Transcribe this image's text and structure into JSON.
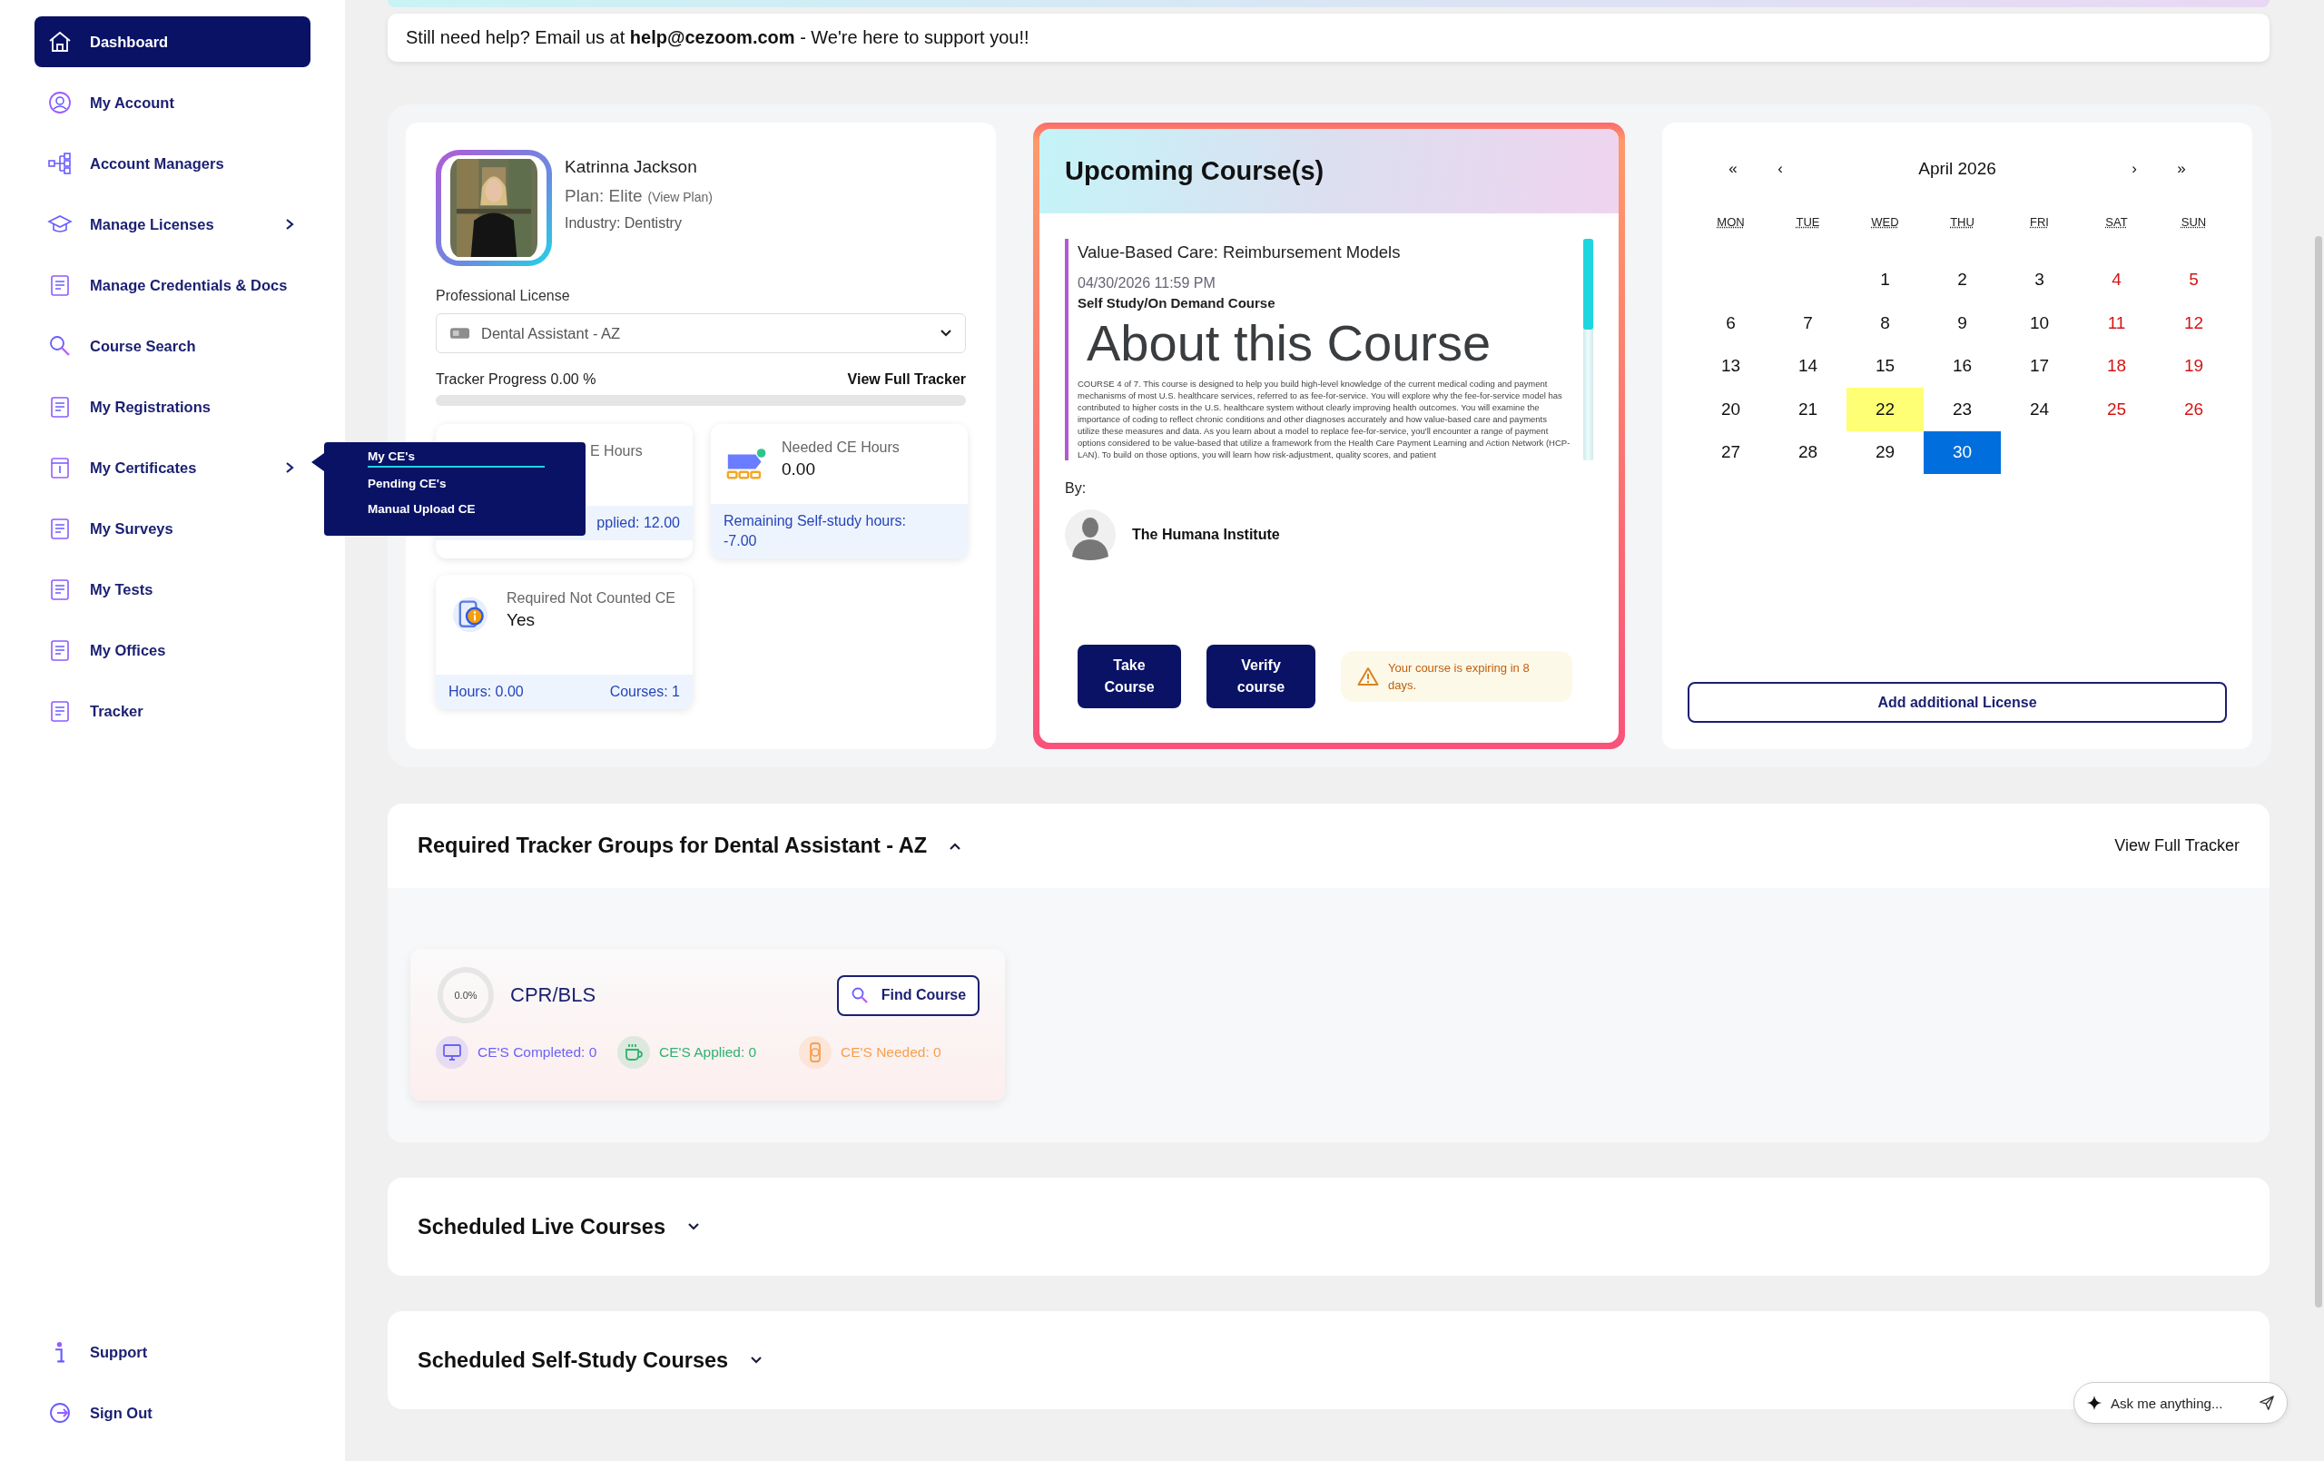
{
  "sidebar": {
    "items": [
      {
        "label": "Dashboard",
        "selected": true,
        "submenu": false
      },
      {
        "label": "My Account",
        "selected": false,
        "submenu": false
      },
      {
        "label": "Account Managers",
        "selected": false,
        "submenu": false
      },
      {
        "label": "Manage Licenses",
        "selected": false,
        "submenu": true
      },
      {
        "label": "Manage Credentials & Docs",
        "selected": false,
        "submenu": false
      },
      {
        "label": "Course Search",
        "selected": false,
        "submenu": false
      },
      {
        "label": "My Registrations",
        "selected": false,
        "submenu": false
      },
      {
        "label": "My Certificates",
        "selected": false,
        "submenu": true
      },
      {
        "label": "My Surveys",
        "selected": false,
        "submenu": false
      },
      {
        "label": "My Tests",
        "selected": false,
        "submenu": false
      },
      {
        "label": "My Offices",
        "selected": false,
        "submenu": false
      },
      {
        "label": "Tracker",
        "selected": false,
        "submenu": false
      }
    ],
    "bottom_items": [
      {
        "label": "Support"
      },
      {
        "label": "Sign Out"
      }
    ]
  },
  "submenu": {
    "items": [
      {
        "label": "My CE's",
        "selected": true
      },
      {
        "label": "Pending CE's",
        "selected": false
      },
      {
        "label": "Manual Upload CE",
        "selected": false
      }
    ]
  },
  "help_banner": "Still need help? Email us at **help@cezoom.com** - We're here to support you!!",
  "profile": {
    "name": "Katrinna Jackson",
    "plan": "Plan: Elite",
    "plan_link": "(View Plan)",
    "industry": "Industry: Dentistry",
    "license_label": "Professional License",
    "license_value": "Dental Assistant - AZ",
    "progress_label": "Tracker Progress 0.00 %",
    "progress_link": "View Full Tracker",
    "level": 0,
    "stats": [
      {
        "label": "E Hours",
        "footer": "pplied: 12.00"
      },
      {
        "label": "Needed CE Hours",
        "value": "0.00",
        "footer": "Remaining Self-study hours: -7.00"
      },
      {
        "label": "Required Not Counted CE",
        "value": "Yes",
        "footer": "Hours: 0.00",
        "footer_2": "Courses: 1"
      }
    ]
  },
  "upcoming": {
    "title": "Upcoming Course(s)",
    "course": {
      "name": "Value-Based Care: Reimbursement Models",
      "date": "04/30/2026 11:59 PM",
      "type": "Self Study/On Demand Course",
      "heading": "About this Course",
      "description": "COURSE 4 of 7. This course is designed to help you build high-level knowledge of the current medical coding and payment mechanisms of most U.S. healthcare services, referred to as fee-for-service. You will explore why the fee-for-service model has contributed to higher costs in the U.S. healthcare system without clearly improving health outcomes. You will examine the importance of coding to reflect chronic conditions and other diagnoses accurately and how value-based care and payments utilize these measures and data. As you learn about a model to replace fee-for-service, you'll encounter a range of payment options considered to be value-based that utilize a framework from the Health Care Payment Learning and Action Network (HCP-LAN). To build on those options, you will learn how risk-adjustment, quality scores, and patient"
    },
    "by_label": "By:",
    "instructor": "The Humana Institute",
    "buttons": [
      "Take Course",
      "Verify course"
    ],
    "warning": "Your course is expiring in 8 days."
  },
  "calendar": {
    "nav_left": [
      "«",
      "‹"
    ],
    "month": "April 2026",
    "nav_right": [
      "›",
      "»"
    ],
    "weekdays": [
      "MON",
      "TUE",
      "WED",
      "THU",
      "FRI",
      "SAT",
      "SUN"
    ],
    "weeks": [
      [
        {
          "day": "1",
          "weekend": false,
          "today": false,
          "selected": false
        },
        {
          "day": "2",
          "weekend": false,
          "today": false,
          "selected": false
        },
        {
          "day": "3",
          "weekend": false,
          "today": false,
          "selected": false
        },
        {
          "day": "4",
          "weekend": true,
          "today": false,
          "selected": false
        },
        {
          "day": "5",
          "weekend": true,
          "today": false,
          "selected": false
        }
      ],
      [
        {
          "day": "6",
          "weekend": false,
          "today": false,
          "selected": false
        },
        {
          "day": "7",
          "weekend": false,
          "today": false,
          "selected": false
        },
        {
          "day": "8",
          "weekend": false,
          "today": false,
          "selected": false
        },
        {
          "day": "9",
          "weekend": false,
          "today": false,
          "selected": false
        },
        {
          "day": "10",
          "weekend": false,
          "today": false,
          "selected": false
        },
        {
          "day": "11",
          "weekend": true,
          "today": false,
          "selected": false
        },
        {
          "day": "12",
          "weekend": true,
          "today": false,
          "selected": false
        }
      ],
      [
        {
          "day": "13",
          "weekend": false,
          "today": false,
          "selected": false
        },
        {
          "day": "14",
          "weekend": false,
          "today": false,
          "selected": false
        },
        {
          "day": "15",
          "weekend": false,
          "today": false,
          "selected": false
        },
        {
          "day": "16",
          "weekend": false,
          "today": false,
          "selected": false
        },
        {
          "day": "17",
          "weekend": false,
          "today": false,
          "selected": false
        },
        {
          "day": "18",
          "weekend": true,
          "today": false,
          "selected": false
        },
        {
          "day": "19",
          "weekend": true,
          "today": false,
          "selected": false
        }
      ],
      [
        {
          "day": "20",
          "weekend": false,
          "today": false,
          "selected": false
        },
        {
          "day": "21",
          "weekend": false,
          "today": false,
          "selected": false
        },
        {
          "day": "22",
          "weekend": false,
          "today": true,
          "selected": false
        },
        {
          "day": "23",
          "weekend": false,
          "today": false,
          "selected": false
        },
        {
          "day": "24",
          "weekend": false,
          "today": false,
          "selected": false
        },
        {
          "day": "25",
          "weekend": true,
          "today": false,
          "selected": false
        },
        {
          "day": "26",
          "weekend": true,
          "today": false,
          "selected": false
        }
      ],
      [
        {
          "day": "27",
          "weekend": false,
          "today": false,
          "selected": false
        },
        {
          "day": "28",
          "weekend": false,
          "today": false,
          "selected": false
        },
        {
          "day": "29",
          "weekend": false,
          "today": false,
          "selected": false
        },
        {
          "day": "30",
          "weekend": false,
          "today": false,
          "selected": true
        }
      ]
    ],
    "add_button": "Add additional License"
  },
  "tracker": {
    "title": "Required Tracker Groups for Dental Assistant - AZ",
    "expanded": true,
    "link": "View Full Tracker",
    "groups": [
      {
        "name": "CPR/BLS",
        "percent": "0.0%",
        "level": 0,
        "button": "Find Course",
        "stats": [
          {
            "label": "CE'S Completed: 0",
            "color": "#6a63f5"
          },
          {
            "label": "CE'S Applied: 0",
            "color": "#2fb36f"
          },
          {
            "label": "CE'S Needed: 0",
            "color": "#f6a04d"
          }
        ]
      }
    ]
  },
  "sections": [
    {
      "title": "Scheduled Live Courses",
      "expanded": false
    },
    {
      "title": "Scheduled Self-Study Courses",
      "expanded": false
    }
  ],
  "chat": {
    "placeholder": "Ask me anything..."
  }
}
